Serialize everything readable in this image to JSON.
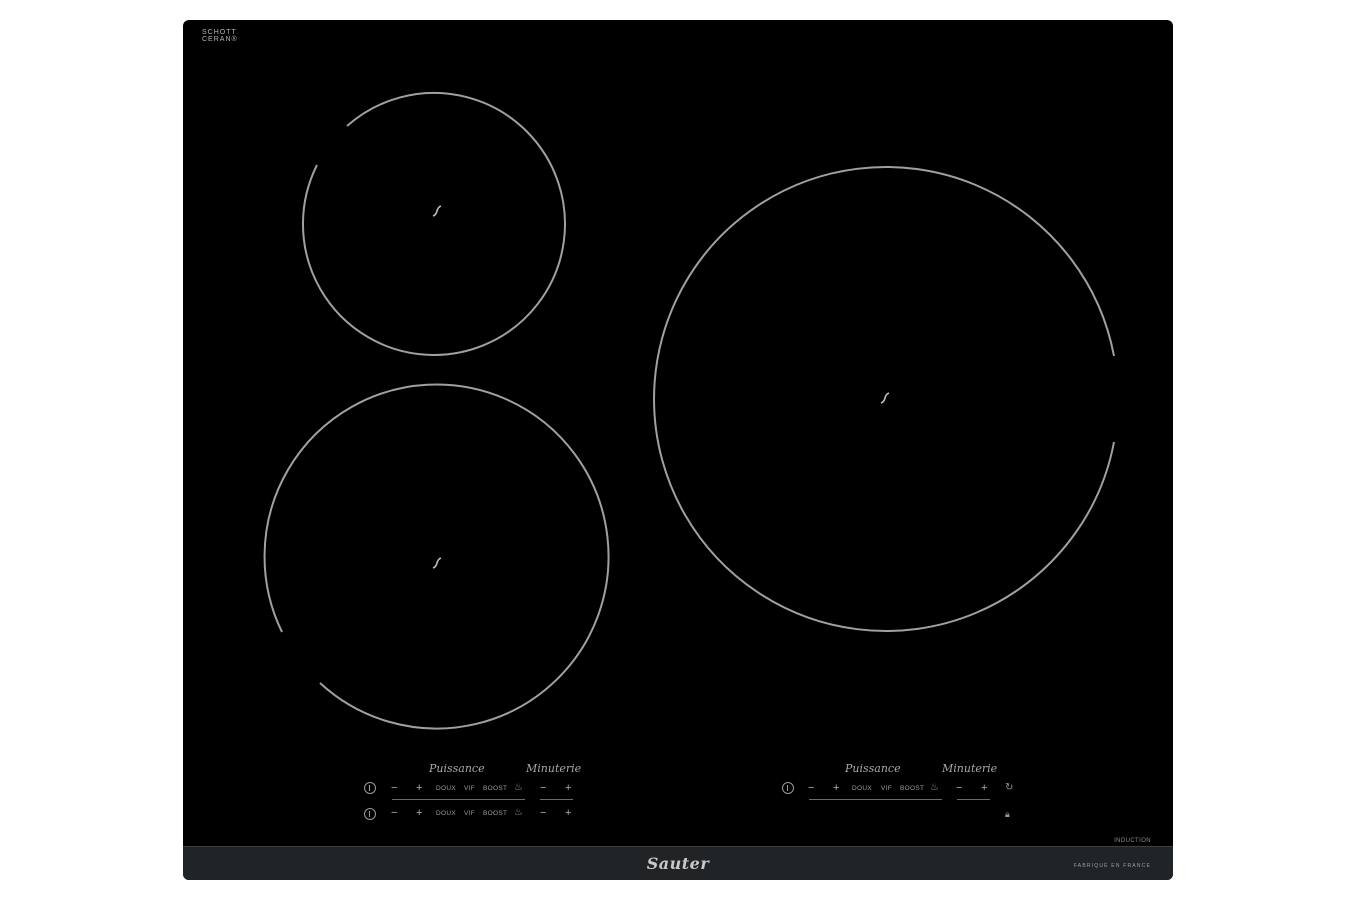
{
  "hob": {
    "logo_line1": "SCHOTT",
    "logo_line2": "CERAN®",
    "brand": "Sauter",
    "made_in": "FABRIQUÉ EN FRANCE",
    "type_label": "INDUCTION"
  },
  "controls_left": {
    "power_label": "Puissance",
    "timer_label": "Minuterie",
    "rows": [
      {
        "minus": "−",
        "plus": "+",
        "doux": "DOUX",
        "vif": "VIF",
        "boost": "BOOST",
        "t_minus": "−",
        "t_plus": "+"
      },
      {
        "minus": "−",
        "plus": "+",
        "doux": "DOUX",
        "vif": "VIF",
        "boost": "BOOST",
        "t_minus": "−",
        "t_plus": "+"
      }
    ]
  },
  "controls_right": {
    "power_label": "Puissance",
    "timer_label": "Minuterie",
    "row": {
      "minus": "−",
      "plus": "+",
      "doux": "DOUX",
      "vif": "VIF",
      "boost": "BOOST",
      "t_minus": "−",
      "t_plus": "+"
    }
  },
  "colors": {
    "glass": "#000000",
    "strip": "#202426",
    "ring": "#a0a0a0"
  }
}
